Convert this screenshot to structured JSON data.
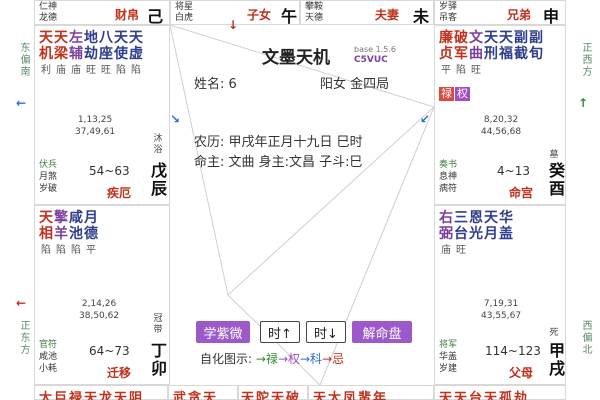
{
  "directions": {
    "left_top": "东偏南",
    "right_top": "正西方",
    "left_bottom": "正东方",
    "right_bottom": "西偏北"
  },
  "header": {
    "app_title": "文墨天机",
    "version": "base 1.5.6",
    "code": "C5VUC"
  },
  "profile": {
    "name": "姓名: 6",
    "gender_ju": "阳女 金四局",
    "lunar": "农历: 甲戌年正月十九日 巳时",
    "ming": "命主: 文曲 身主:文昌 子斗:巳"
  },
  "top_strip": [
    {
      "small1": "仁神",
      "small2": "龙德",
      "palace": "财帛",
      "gz": "己巳"
    },
    {
      "small1": "将星",
      "small2": "白虎",
      "palace": "子女",
      "gz": "午"
    },
    {
      "small1": "攀鞍",
      "small2": "天德",
      "palace": "夫妻",
      "gz": "未"
    },
    {
      "small1": "岁驿",
      "small2": "吊客",
      "palace": "兄弟",
      "gz": "申"
    }
  ],
  "palaces": {
    "left1": {
      "stars": [
        {
          "t": "天",
          "b": "",
          "c": "main"
        },
        {
          "t": "天",
          "b": "",
          "c": "main"
        },
        {
          "t": "左",
          "b": "",
          "c": "aux"
        },
        {
          "t": "地",
          "b": "",
          "c": "misc"
        },
        {
          "t": "八",
          "b": "",
          "c": "misc"
        },
        {
          "t": "天",
          "b": "",
          "c": "misc"
        },
        {
          "t": "天",
          "b": "",
          "c": "misc"
        }
      ],
      "stars2": [
        {
          "t": "机",
          "b": "利",
          "c": "main"
        },
        {
          "t": "梁",
          "b": "庙",
          "c": "main"
        },
        {
          "t": "辅",
          "b": "庙",
          "c": "aux"
        },
        {
          "t": "劫",
          "b": "旺",
          "c": "misc"
        },
        {
          "t": "座",
          "b": "旺",
          "c": "misc"
        },
        {
          "t": "使",
          "b": "陷",
          "c": "misc"
        },
        {
          "t": "虚",
          "b": "陷",
          "c": "misc"
        }
      ],
      "nums": "1,13,25\n37,49,61",
      "state": "沐浴",
      "s1": "伏兵",
      "s2": "月煞",
      "s3": "岁破",
      "range": "54~63",
      "palace": "疾厄",
      "gz": "戊辰"
    },
    "right1": {
      "stars": [
        {
          "t": "廉",
          "b": "平",
          "c": "main"
        },
        {
          "t": "破",
          "b": "陷",
          "c": "main"
        },
        {
          "t": "文",
          "b": "旺",
          "c": "aux"
        },
        {
          "t": "天",
          "b": "",
          "c": "misc"
        },
        {
          "t": "天",
          "b": "",
          "c": "misc"
        },
        {
          "t": "副",
          "b": "",
          "c": "misc"
        },
        {
          "t": "副",
          "b": "",
          "c": "misc"
        }
      ],
      "stars2": [
        {
          "t": "贞",
          "b": "",
          "c": "main"
        },
        {
          "t": "军",
          "b": "",
          "c": "main"
        },
        {
          "t": "曲",
          "b": "",
          "c": "aux"
        },
        {
          "t": "刑",
          "b": "",
          "c": "misc"
        },
        {
          "t": "福",
          "b": "",
          "c": "misc"
        },
        {
          "t": "截",
          "b": "",
          "c": "misc"
        },
        {
          "t": "旬",
          "b": "",
          "c": "misc"
        }
      ],
      "hua": [
        {
          "t": "禄",
          "k": "lu"
        },
        {
          "t": "权",
          "k": "quan"
        }
      ],
      "nums": "8,20,32\n44,56,68",
      "state": "墓",
      "s1": "奏书",
      "s2": "息神",
      "s3": "病符",
      "range": "4~13",
      "palace": "命宫",
      "gz": "癸酉"
    },
    "left2": {
      "stars": [
        {
          "t": "天",
          "b": "陷",
          "c": "main"
        },
        {
          "t": "擎",
          "b": "陷",
          "c": "aux"
        },
        {
          "t": "咸",
          "b": "陷",
          "c": "misc"
        },
        {
          "t": "月",
          "b": "平",
          "c": "misc"
        }
      ],
      "stars2": [
        {
          "t": "相",
          "b": "",
          "c": "main"
        },
        {
          "t": "羊",
          "b": "",
          "c": "aux"
        },
        {
          "t": "池",
          "b": "",
          "c": "misc"
        },
        {
          "t": "德",
          "b": "",
          "c": "misc"
        }
      ],
      "nums": "2,14,26\n38,50,62",
      "state": "冠带",
      "s1": "官符",
      "s2": "咸池",
      "s3": "小耗",
      "range": "64~73",
      "palace": "迁移",
      "gz": "丁卯"
    },
    "right2": {
      "stars": [
        {
          "t": "右",
          "b": "庙",
          "c": "aux"
        },
        {
          "t": "三",
          "b": "旺",
          "c": "misc"
        },
        {
          "t": "恩",
          "b": "",
          "c": "misc"
        },
        {
          "t": "天",
          "b": "",
          "c": "misc"
        },
        {
          "t": "华",
          "b": "",
          "c": "misc"
        }
      ],
      "stars2": [
        {
          "t": "弼",
          "b": "",
          "c": "aux"
        },
        {
          "t": "台",
          "b": "",
          "c": "misc"
        },
        {
          "t": "光",
          "b": "",
          "c": "misc"
        },
        {
          "t": "月",
          "b": "",
          "c": "misc"
        },
        {
          "t": "盖",
          "b": "",
          "c": "misc"
        }
      ],
      "nums": "7,19,31\n43,55,67",
      "state": "死",
      "s1": "将军",
      "s2": "华盖",
      "s3": "岁建",
      "range": "114~123",
      "palace": "父母",
      "gz": "甲戌"
    }
  },
  "bottom_strip": {
    "b0": "太巨禄天龙天阴",
    "b1": "武贪天",
    "b2": "天陀天破",
    "b3": "天太凤蜚年",
    "b4": "天天台天孤劫"
  },
  "buttons": {
    "study": "学紫微",
    "time_up": "时↑",
    "time_down": "时↓",
    "solve": "解命盘"
  },
  "legend": {
    "prefix": "自化图示:",
    "lu": "→禄",
    "quan": "→权",
    "ke": "→科",
    "ji": "→忌"
  },
  "colors": {
    "main_star": "#c0301c",
    "aux_star": "#7b3fa0",
    "misc_star": "#2e3d8c",
    "purple_button": "#9b59c9"
  }
}
